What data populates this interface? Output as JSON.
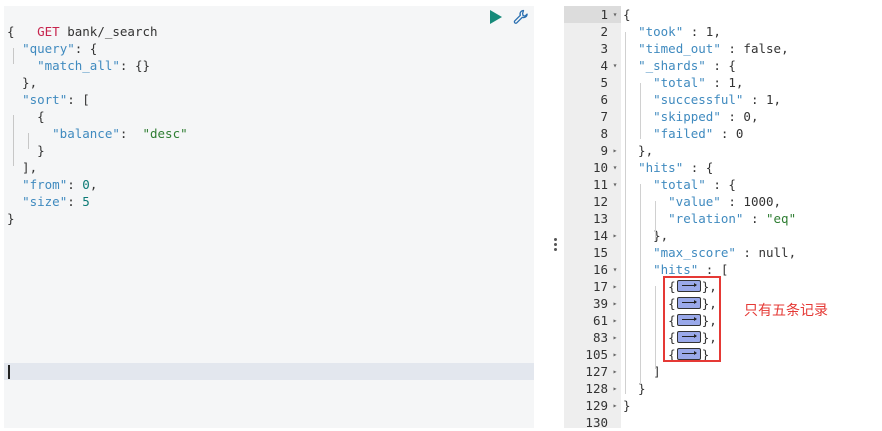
{
  "request": {
    "method": "GET",
    "path": "bank/_search",
    "lines": [
      "{",
      "  \"query\": {",
      "    \"match_all\": {}",
      "  },",
      "  \"sort\": [",
      "    {",
      "      \"balance\":  \"desc\"",
      "    }",
      "  ],",
      "  \"from\": 0,",
      "  \"size\": 5",
      "}"
    ]
  },
  "toolbar": {
    "run_icon": "play-icon",
    "settings_icon": "wrench-icon"
  },
  "response": {
    "line_numbers": [
      "1",
      "2",
      "3",
      "4",
      "5",
      "6",
      "7",
      "8",
      "9",
      "10",
      "11",
      "12",
      "13",
      "14",
      "15",
      "16",
      "17",
      "39",
      "61",
      "83",
      "105",
      "127",
      "128",
      "129",
      "130"
    ],
    "lines": [
      "{",
      "  \"took\" : 1,",
      "  \"timed_out\" : false,",
      "  \"_shards\" : {",
      "    \"total\" : 1,",
      "    \"successful\" : 1,",
      "    \"skipped\" : 0,",
      "    \"failed\" : 0",
      "  },",
      "  \"hits\" : {",
      "    \"total\" : {",
      "      \"value\" : 1000,",
      "      \"relation\" : \"eq\"",
      "    },",
      "    \"max_score\" : null,",
      "    \"hits\" : [",
      "      {",
      "      {",
      "      {",
      "      {",
      "      {",
      "    ]",
      "  }",
      "}",
      ""
    ],
    "collapsed_suffixes": [
      "},",
      "},",
      "},",
      "},",
      "}"
    ]
  },
  "annotation": "只有五条记录",
  "colors": {
    "highlight": "#e53935",
    "key": "#3f8abf",
    "string": "#2e7d32",
    "method": "#c7254e"
  }
}
